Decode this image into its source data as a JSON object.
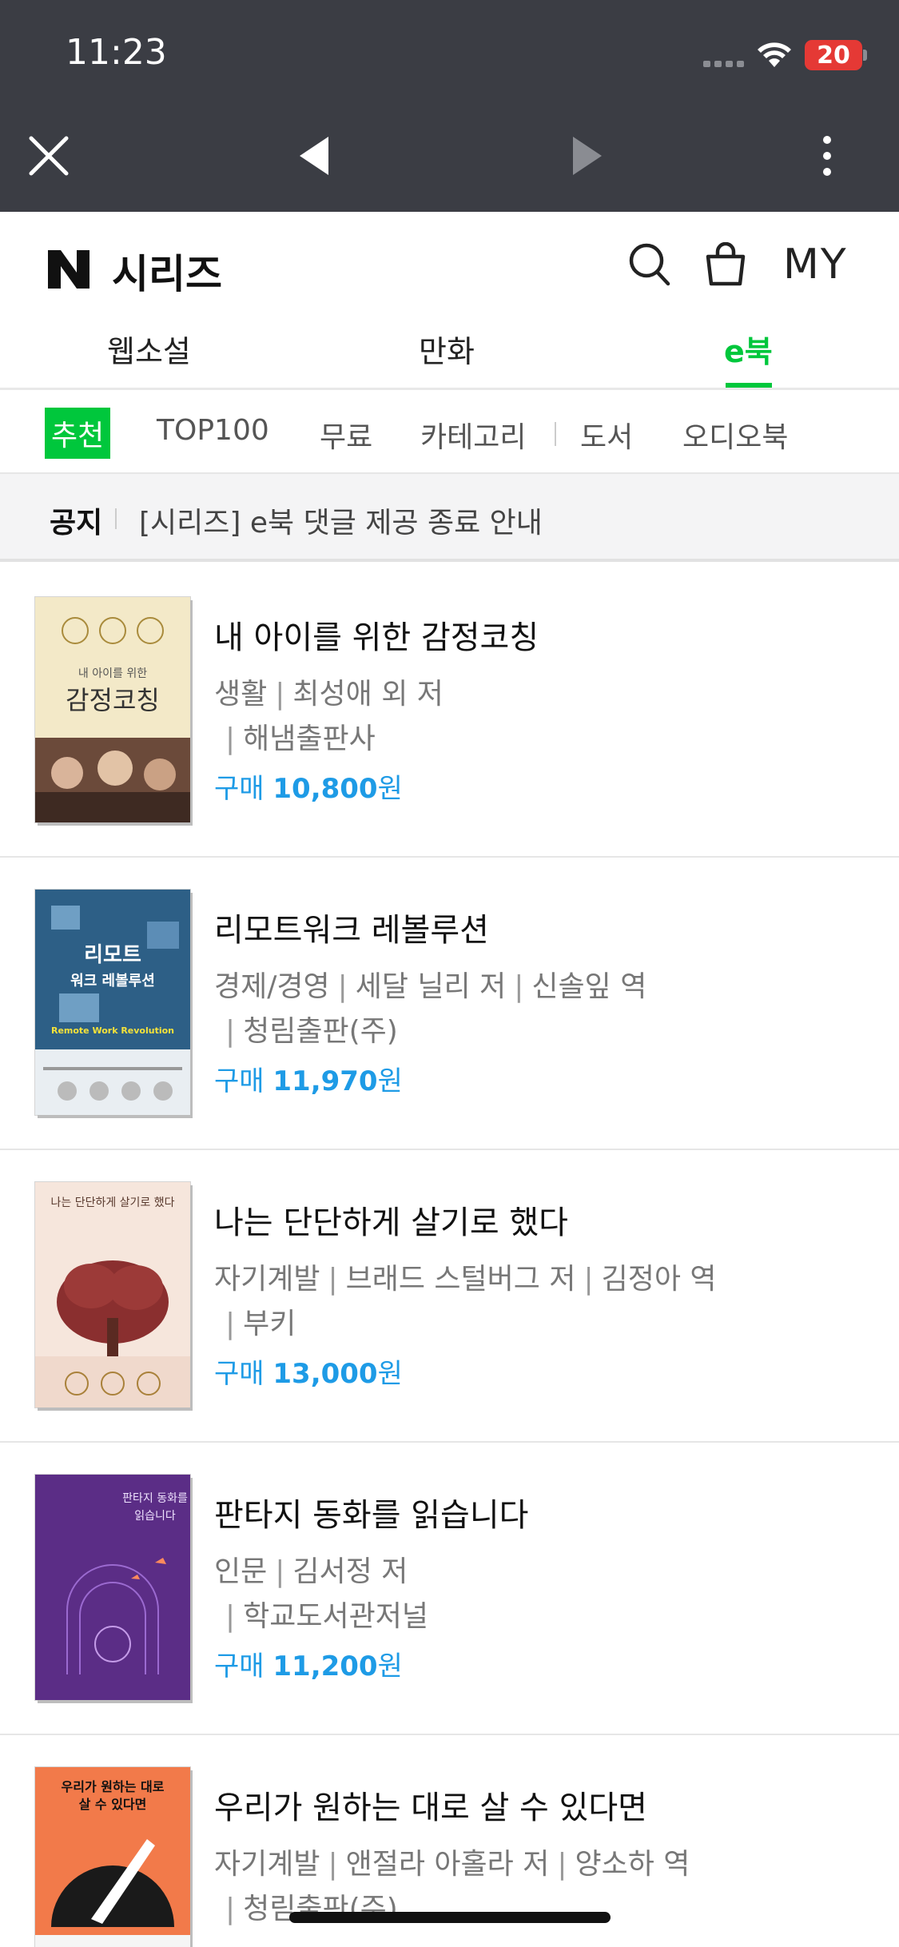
{
  "status_bar": {
    "time": "11:23",
    "battery": "20"
  },
  "brand": {
    "name": "시리즈"
  },
  "header": {
    "my_label": "MY"
  },
  "main_tabs": [
    {
      "label": "웹소설"
    },
    {
      "label": "만화"
    },
    {
      "label": "e북"
    }
  ],
  "sub_tabs": [
    {
      "label": "추천"
    },
    {
      "label": "TOP100"
    },
    {
      "label": "무료"
    },
    {
      "label": "카테고리"
    },
    {
      "label": "도서"
    },
    {
      "label": "오디오북"
    }
  ],
  "notice": {
    "label": "공지",
    "text": "[시리즈] e북 댓글 제공 종료 안내"
  },
  "books": [
    {
      "title": "내 아이를 위한 감정코칭",
      "category": "생활",
      "author": "최성애 외  저",
      "translator": "",
      "publisher": "해냄출판사",
      "price_prefix": "구매",
      "price": "10,800",
      "price_unit": "원"
    },
    {
      "title": "리모트워크 레볼루션",
      "category": "경제/경영",
      "author": "세달 닐리  저",
      "translator": "신솔잎  역",
      "publisher": "청림출판(주)",
      "price_prefix": "구매",
      "price": "11,970",
      "price_unit": "원"
    },
    {
      "title": "나는 단단하게 살기로 했다",
      "category": "자기계발",
      "author": "브래드 스털버그  저",
      "translator": "김정아  역",
      "publisher": "부키",
      "price_prefix": "구매",
      "price": "13,000",
      "price_unit": "원"
    },
    {
      "title": "판타지 동화를 읽습니다",
      "category": "인문",
      "author": "김서정  저",
      "translator": "",
      "publisher": "학교도서관저널",
      "price_prefix": "구매",
      "price": "11,200",
      "price_unit": "원"
    },
    {
      "title": "우리가 원하는 대로 살 수 있다면",
      "category": "자기계발",
      "author": "앤절라 아홀라  저",
      "translator": "양소하  역",
      "publisher": "청림출판(주)",
      "price_prefix": "",
      "price": "",
      "price_unit": ""
    }
  ],
  "covers": [
    {
      "title_line1": "내 아이를 위한",
      "title_line2": "감정코칭"
    },
    {
      "title_line1": "리모트",
      "title_line2": "워크 레볼루션",
      "subtitle": "Remote Work Revolution"
    },
    {
      "title_line1": "나는 단단하게 살기로 했다"
    },
    {
      "title_line1": "판타지 동화를",
      "title_line2": "읽습니다"
    },
    {
      "title_line1": "우리가 원하는 대로",
      "title_line2": "살 수 있다면"
    }
  ],
  "colors": {
    "accent": "#00c73c",
    "price": "#1e9be6",
    "topbar": "#3b3d44"
  },
  "icons": {
    "close": "close-icon",
    "back": "back-arrow-icon",
    "forward": "forward-arrow-icon",
    "more": "more-icon",
    "search": "search-icon",
    "cart": "cart-icon"
  }
}
